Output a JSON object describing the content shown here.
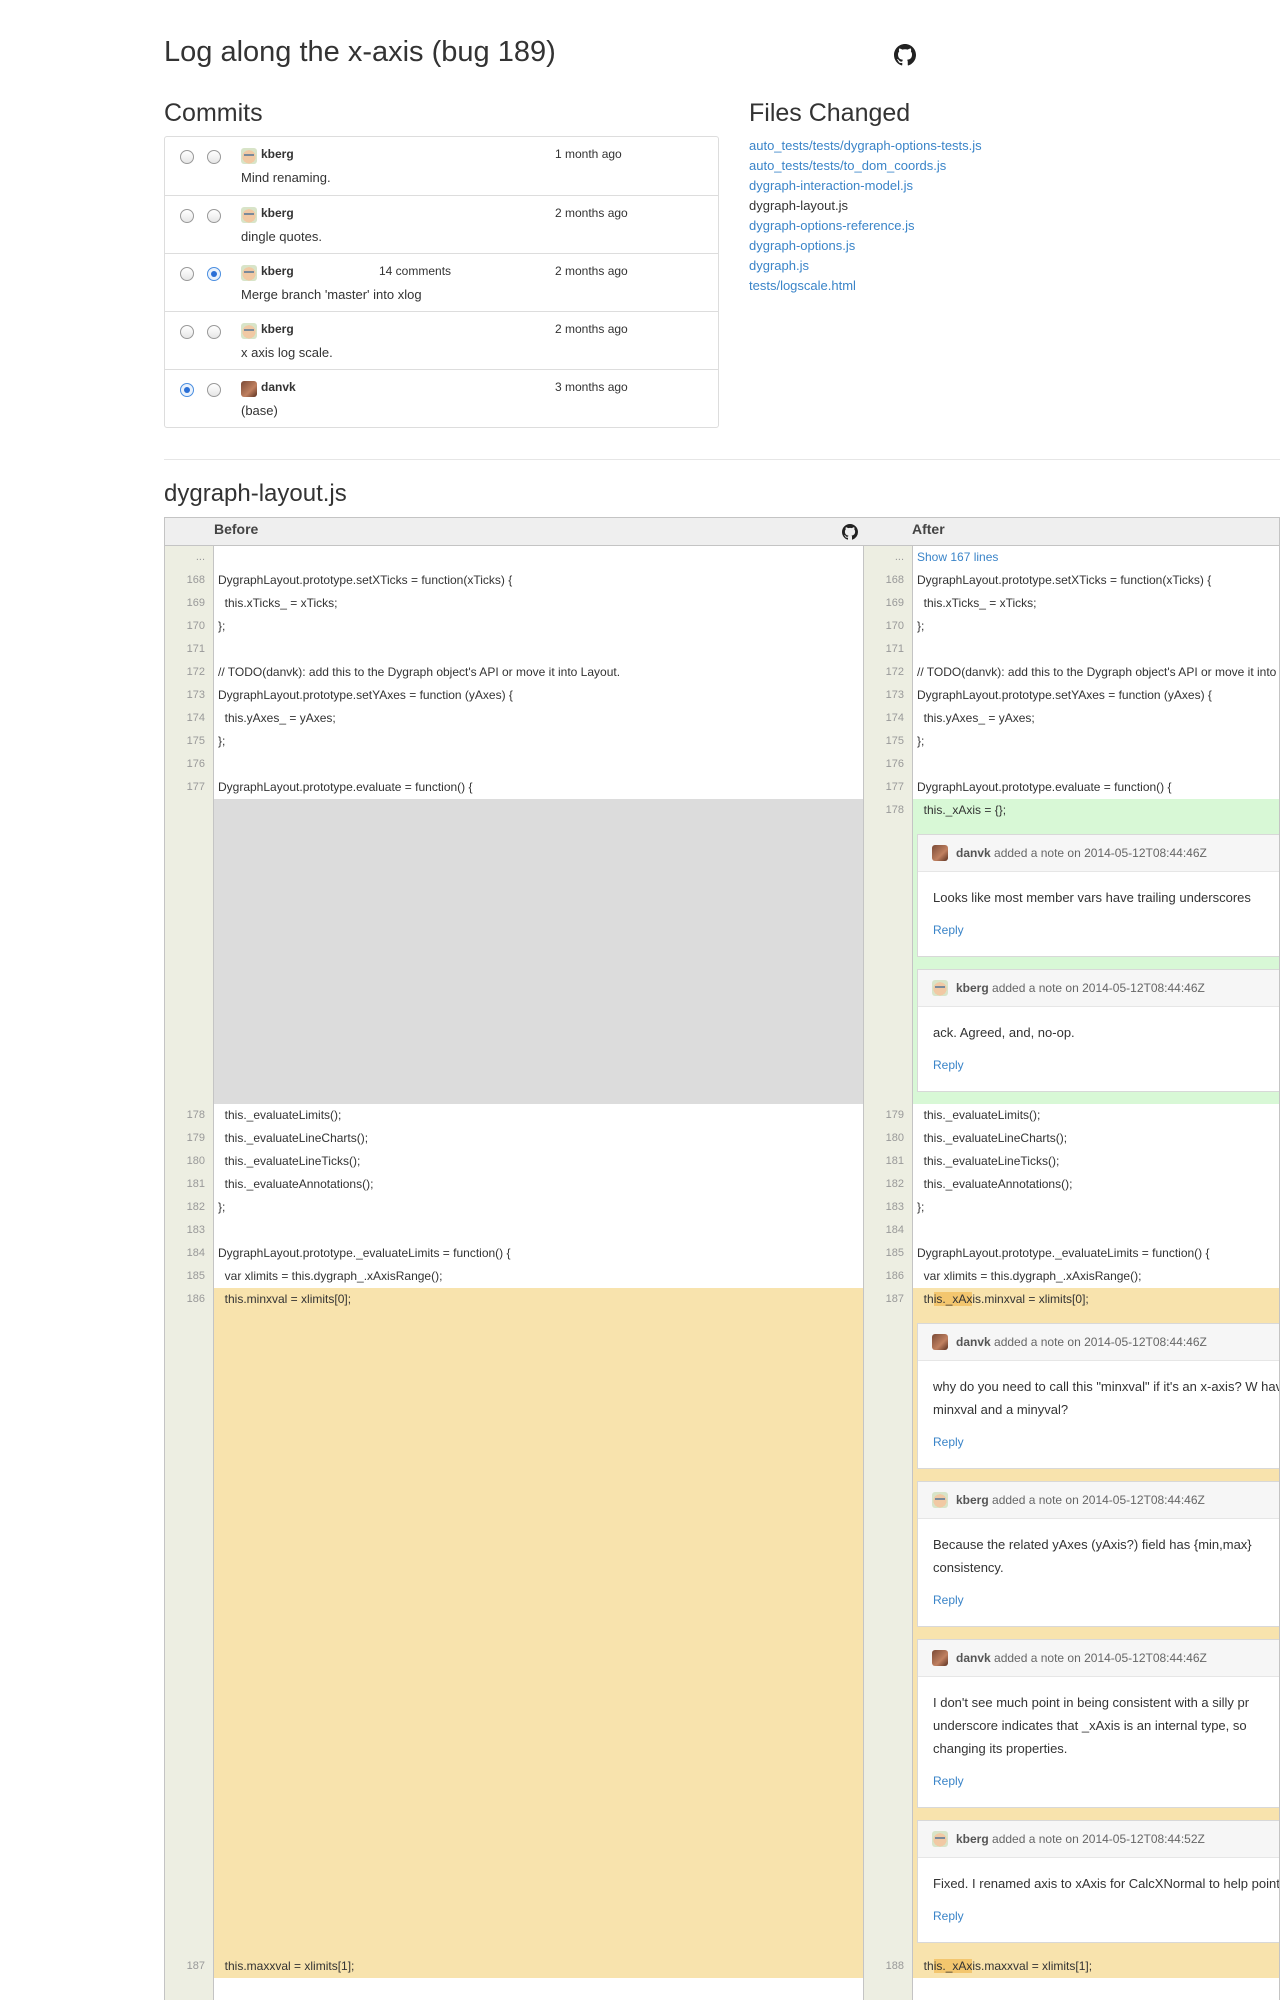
{
  "title": "Log along the x-axis (bug 189)",
  "commits_heading": "Commits",
  "files_heading": "Files Changed",
  "commits": [
    {
      "author": "kberg",
      "time": "1 month ago",
      "message": "Mind renaming.",
      "comments": ""
    },
    {
      "author": "kberg",
      "time": "2 months ago",
      "message": "dingle quotes.",
      "comments": ""
    },
    {
      "author": "kberg",
      "time": "2 months ago",
      "message": "Merge branch 'master' into xlog",
      "comments": "14 comments"
    },
    {
      "author": "kberg",
      "time": "2 months ago",
      "message": "x axis log scale.",
      "comments": ""
    },
    {
      "author": "danvk",
      "time": "3 months ago",
      "message": "(base)",
      "comments": ""
    }
  ],
  "files": [
    "auto_tests/tests/dygraph-options-tests.js",
    "auto_tests/tests/to_dom_coords.js",
    "dygraph-interaction-model.js",
    "dygraph-layout.js",
    "dygraph-options-reference.js",
    "dygraph-options.js",
    "dygraph.js",
    "tests/logscale.html"
  ],
  "diff": {
    "filename": "dygraph-layout.js",
    "before_label": "Before",
    "after_label": "After",
    "ellipsis": "...",
    "show_lines": "Show 167 lines",
    "lines_a": [
      {
        "l": "168",
        "r": "168",
        "lt": "DygraphLayout.prototype.setXTicks = function(xTicks) {",
        "rt": "DygraphLayout.prototype.setXTicks = function(xTicks) {"
      },
      {
        "l": "169",
        "r": "169",
        "lt": "  this.xTicks_ = xTicks;",
        "rt": "  this.xTicks_ = xTicks;"
      },
      {
        "l": "170",
        "r": "170",
        "lt": "};",
        "rt": "};"
      },
      {
        "l": "171",
        "r": "171",
        "lt": "",
        "rt": ""
      },
      {
        "l": "172",
        "r": "172",
        "lt": "// TODO(danvk): add this to the Dygraph object's API or move it into Layout.",
        "rt": "// TODO(danvk): add this to the Dygraph object's API or move it into Layout."
      },
      {
        "l": "173",
        "r": "173",
        "lt": "DygraphLayout.prototype.setYAxes = function (yAxes) {",
        "rt": "DygraphLayout.prototype.setYAxes = function (yAxes) {"
      },
      {
        "l": "174",
        "r": "174",
        "lt": "  this.yAxes_ = yAxes;",
        "rt": "  this.yAxes_ = yAxes;"
      },
      {
        "l": "175",
        "r": "175",
        "lt": "};",
        "rt": "};"
      },
      {
        "l": "176",
        "r": "176",
        "lt": "",
        "rt": ""
      },
      {
        "l": "177",
        "r": "177",
        "lt": "DygraphLayout.prototype.evaluate = function() {",
        "rt": "DygraphLayout.prototype.evaluate = function() {"
      }
    ],
    "added_line": {
      "r": "178",
      "rt": "  this._xAxis = {};"
    },
    "lines_b": [
      {
        "l": "178",
        "r": "179",
        "lt": "  this._evaluateLimits();",
        "rt": "  this._evaluateLimits();"
      },
      {
        "l": "179",
        "r": "180",
        "lt": "  this._evaluateLineCharts();",
        "rt": "  this._evaluateLineCharts();"
      },
      {
        "l": "180",
        "r": "181",
        "lt": "  this._evaluateLineTicks();",
        "rt": "  this._evaluateLineTicks();"
      },
      {
        "l": "181",
        "r": "182",
        "lt": "  this._evaluateAnnotations();",
        "rt": "  this._evaluateAnnotations();"
      },
      {
        "l": "182",
        "r": "183",
        "lt": "};",
        "rt": "};"
      },
      {
        "l": "183",
        "r": "184",
        "lt": "",
        "rt": ""
      },
      {
        "l": "184",
        "r": "185",
        "lt": "DygraphLayout.prototype._evaluateLimits = function() {",
        "rt": "DygraphLayout.prototype._evaluateLimits = function() {"
      },
      {
        "l": "185",
        "r": "186",
        "lt": "  var xlimits = this.dygraph_.xAxisRange();",
        "rt": "  var xlimits = this.dygraph_.xAxisRange();"
      }
    ],
    "changed_1": {
      "l": "186",
      "r": "187",
      "lt": "  this.minxval = xlimits[0];",
      "rt_pre": "  th",
      "rt_hl": "is._xAx",
      "rt_post": "is.minxval = xlimits[0];"
    },
    "changed_2": {
      "l": "187",
      "r": "188",
      "lt": "  this.maxxval = xlimits[1];",
      "rt_pre": "  th",
      "rt_hl": "is._xAx",
      "rt_post": "is.maxxval = xlimits[1];"
    },
    "notes_1": [
      {
        "author": "danvk",
        "action": "added a note on 2014-05-12T08:44:46Z",
        "text": "Looks like most member vars have trailing underscores",
        "reply": "Reply"
      },
      {
        "author": "kberg",
        "action": "added a note on 2014-05-12T08:44:46Z",
        "text": "ack. Agreed, and, no-op.",
        "reply": "Reply"
      }
    ],
    "notes_2": [
      {
        "author": "danvk",
        "action": "added a note on 2014-05-12T08:44:46Z",
        "text": "why do you need to call this \"minxval\" if it's an x-axis? W have a minxval and a minyval?",
        "reply": "Reply"
      },
      {
        "author": "kberg",
        "action": "added a note on 2014-05-12T08:44:46Z",
        "text": "Because the related yAxes (yAxis?) field has {min,max} consistency.",
        "reply": "Reply"
      },
      {
        "author": "danvk",
        "action": "added a note on 2014-05-12T08:44:46Z",
        "text": "I don't see much point in being consistent with a silly pr underscore indicates that _xAxis is an internal type, so changing its properties.",
        "reply": "Reply"
      },
      {
        "author": "kberg",
        "action": "added a note on 2014-05-12T08:44:52Z",
        "text": "Fixed. I renamed axis to xAxis for CalcXNormal to help point.",
        "reply": "Reply"
      }
    ]
  }
}
